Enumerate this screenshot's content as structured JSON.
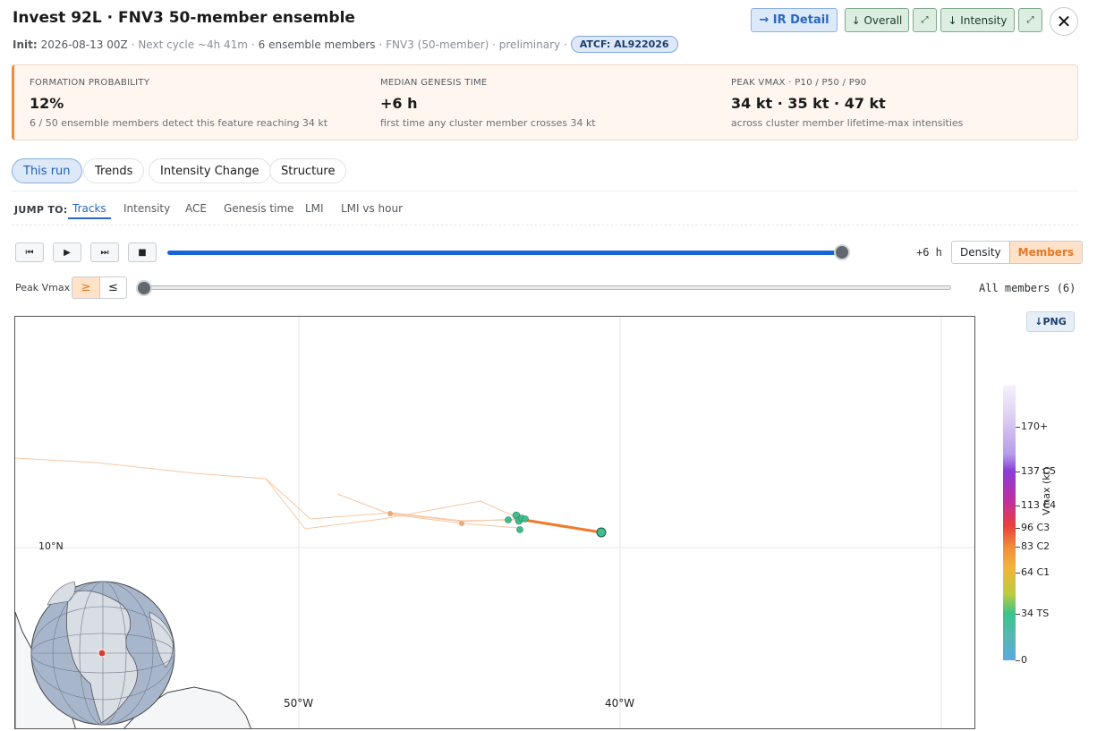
{
  "header": {
    "title": "Invest 92L · FNV3 50-member ensemble",
    "init_label": "Init:",
    "init_value": "2026-08-13 00Z",
    "next_cycle": "· Next cycle ~4h 41m ·",
    "members_count": "6 ensemble members",
    "model_note": "· FNV3 (50-member) · preliminary ·",
    "atcf": "ATCF: AL922026"
  },
  "toolbar": {
    "ir_detail": "→ IR Detail",
    "overall": "↓ Overall",
    "expand1": "⤢",
    "intensity": "↓ Intensity",
    "expand2": "⤢",
    "close": "✕"
  },
  "summary": {
    "formation": {
      "label": "FORMATION PROBABILITY",
      "value": "12%",
      "note": "6 / 50 ensemble members detect this feature reaching 34 kt"
    },
    "genesis": {
      "label": "MEDIAN GENESIS TIME",
      "value": "+6 h",
      "note": "first time any cluster member crosses 34 kt"
    },
    "vmax": {
      "label": "PEAK VMAX · P10 / P50 / P90",
      "value": "34 kt · 35 kt · 47 kt",
      "note": "across cluster member lifetime-max intensities"
    }
  },
  "tabs": [
    "This run",
    "Trends",
    "Intensity Change",
    "Structure"
  ],
  "jump": {
    "label": "JUMP TO:",
    "items": [
      "Tracks",
      "Intensity",
      "ACE",
      "Genesis time",
      "LMI",
      "LMI vs hour"
    ]
  },
  "player": {
    "first": "⏮",
    "play": "▶",
    "next": "⏭",
    "stop": "■",
    "progress": 1.0,
    "time_readout": "+6 h",
    "modes": [
      "Density",
      "Members"
    ],
    "active_mode": "Members"
  },
  "vmax_filter": {
    "label": "Peak Vmax",
    "ge": "≥",
    "le": "≤",
    "level": 0,
    "readout": "All members (6)"
  },
  "map": {
    "png_button": "↓PNG",
    "lat_label": "10°N",
    "lon_labels": [
      "50°W",
      "40°W"
    ]
  },
  "colorbar": {
    "title": "Vmax (kt)",
    "ticks": [
      "170+",
      "137 C5",
      "113 C4",
      "96 C3",
      "83 C2",
      "64 C1",
      "34 TS",
      "0"
    ]
  },
  "colors": {
    "accent": "#2968c0",
    "track_orange": "#f07a2a",
    "member_green": "#3dbf8e",
    "summary_border": "#f08a3c"
  }
}
